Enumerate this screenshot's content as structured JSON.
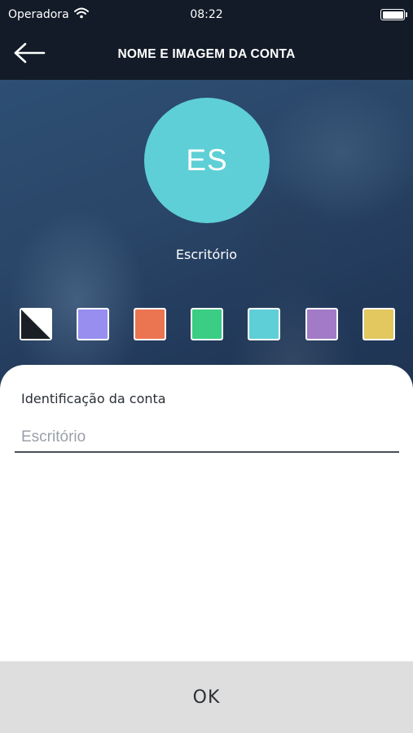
{
  "status_bar": {
    "carrier": "Operadora",
    "time": "08:22"
  },
  "nav": {
    "title": "NOME E IMAGEM DA CONTA"
  },
  "profile": {
    "initials": "ES",
    "name": "Escritório",
    "avatar_color": "#5ecfd6"
  },
  "colors": [
    {
      "name": "none",
      "hex": "#ffffff"
    },
    {
      "name": "periwinkle",
      "hex": "#978ef0"
    },
    {
      "name": "orange",
      "hex": "#ec7551"
    },
    {
      "name": "green",
      "hex": "#3acd83"
    },
    {
      "name": "cyan",
      "hex": "#5ecfd6"
    },
    {
      "name": "purple",
      "hex": "#a27ac6"
    },
    {
      "name": "yellow",
      "hex": "#e2c85f"
    }
  ],
  "form": {
    "label": "Identificação da conta",
    "placeholder": "Escritório"
  },
  "footer": {
    "ok_label": "OK"
  }
}
